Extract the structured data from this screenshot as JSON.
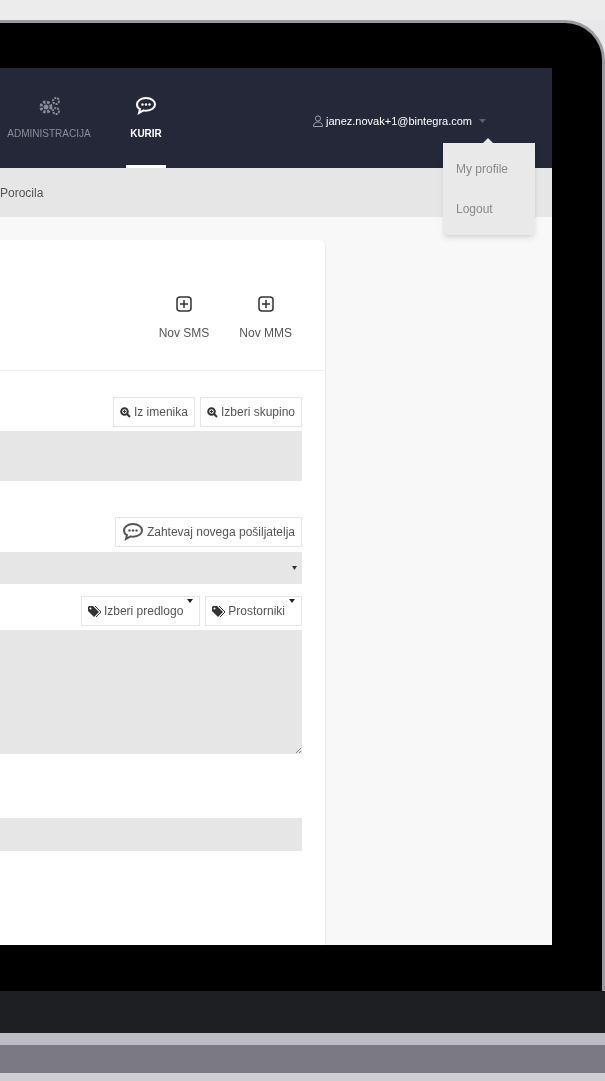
{
  "nav": {
    "items": [
      {
        "label": "ADMINISTRACIJA",
        "selected": false
      },
      {
        "label": "KURIR",
        "selected": true
      }
    ]
  },
  "user_menu": {
    "email": "janez.novak+1@bintegra.com",
    "expanded": true,
    "items": [
      "My profile",
      "Logout"
    ]
  },
  "breadcrumb": "Porocila",
  "card": {
    "actions": [
      "Nov SMS",
      "Nov MMS"
    ],
    "sections": [
      {
        "kind": "buttons_field",
        "buttons": [
          {
            "label": "Iz imenika"
          },
          {
            "label": "Izberi skupino"
          }
        ]
      },
      {
        "kind": "buttons_select",
        "buttons": [
          {
            "label": "Zahtevaj novega pošiljatelja"
          }
        ]
      },
      {
        "kind": "buttons_textarea",
        "buttons": [
          {
            "label": "Izberi predlogo"
          },
          {
            "label": "Prostorniki"
          }
        ]
      },
      {
        "kind": "field"
      }
    ]
  }
}
